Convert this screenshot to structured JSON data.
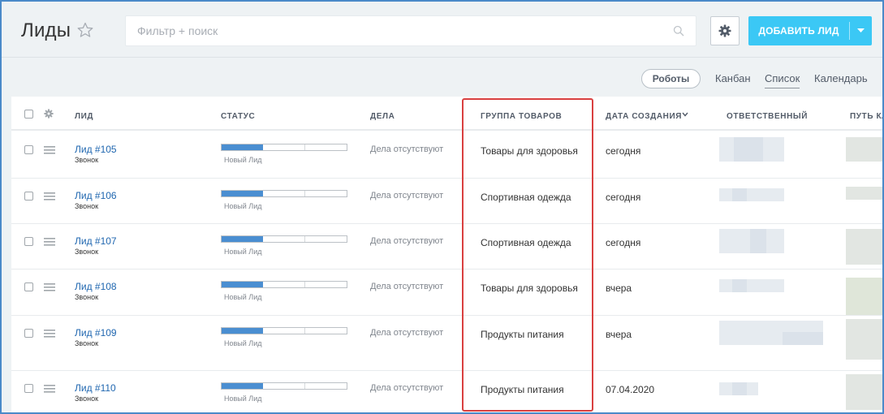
{
  "header": {
    "title": "Лиды",
    "search_placeholder": "Фильтр + поиск",
    "add_button_label": "ДОБАВИТЬ ЛИД"
  },
  "views": {
    "robots_label": "Роботы",
    "tabs": [
      {
        "label": "Канбан",
        "active": false
      },
      {
        "label": "Список",
        "active": true
      },
      {
        "label": "Календарь",
        "active": false
      }
    ]
  },
  "table": {
    "columns": [
      "ЛИД",
      "СТАТУС",
      "ДЕЛА",
      "ГРУППА ТОВАРОВ",
      "ДАТА СОЗДАНИЯ",
      "ОТВЕТСТВЕННЫЙ",
      "ПУТЬ КЛ"
    ],
    "rows": [
      {
        "lead": "Лид #105",
        "source": "Звонок",
        "status": "Новый Лид",
        "progress": 0.33,
        "deals": "Дела отсутствуют",
        "group": "Товары для здоровья",
        "date": "сегодня"
      },
      {
        "lead": "Лид #106",
        "source": "Звонок",
        "status": "Новый Лид",
        "progress": 0.33,
        "deals": "Дела отсутствуют",
        "group": "Спортивная одежда",
        "date": "сегодня"
      },
      {
        "lead": "Лид #107",
        "source": "Звонок",
        "status": "Новый Лид",
        "progress": 0.33,
        "deals": "Дела отсутствуют",
        "group": "Спортивная одежда",
        "date": "сегодня"
      },
      {
        "lead": "Лид #108",
        "source": "Звонок",
        "status": "Новый Лид",
        "progress": 0.33,
        "deals": "Дела отсутствуют",
        "group": "Товары для здоровья",
        "date": "вчера"
      },
      {
        "lead": "Лид #109",
        "source": "Звонок",
        "status": "Новый Лид",
        "progress": 0.33,
        "deals": "Дела отсутствуют",
        "group": "Продукты питания",
        "date": "вчера"
      },
      {
        "lead": "Лид #110",
        "source": "Звонок",
        "status": "Новый Лид",
        "progress": 0.33,
        "deals": "Дела отсутствуют",
        "group": "Продукты питания",
        "date": "07.04.2020"
      }
    ]
  },
  "colors": {
    "accent": "#3bc8f5",
    "link": "#2067b0",
    "progress": "#4a8ed1",
    "highlight": "#d94040"
  },
  "icons": [
    "star-icon",
    "search-icon",
    "gear-icon",
    "chevron-down-icon",
    "drag-handle-icon",
    "sort-arrow-icon"
  ]
}
